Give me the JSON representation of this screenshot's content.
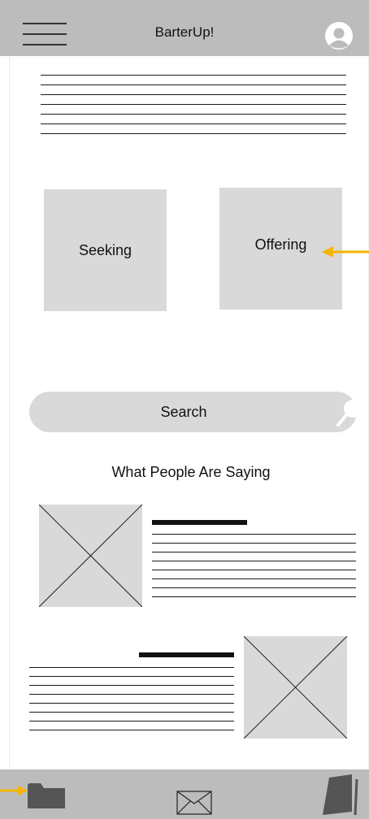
{
  "header": {
    "app_title": "BarterUp!",
    "menu_icon": "hamburger-menu-icon",
    "profile_icon": "user-avatar-icon"
  },
  "choices": {
    "seeking_label": "Seeking",
    "offering_label": "Offering"
  },
  "search": {
    "placeholder": "Search",
    "icon": "magnifier-icon"
  },
  "testimonials": {
    "section_title": "What People Are Saying"
  },
  "bottom_nav": {
    "items": [
      "folder-icon",
      "envelope-icon",
      "notebook-icon"
    ]
  },
  "colors": {
    "header_bg": "#bcbcbc",
    "card_bg": "#d9d9d9",
    "annotation_arrow": "#f5b400",
    "icon_dark": "#555555"
  }
}
